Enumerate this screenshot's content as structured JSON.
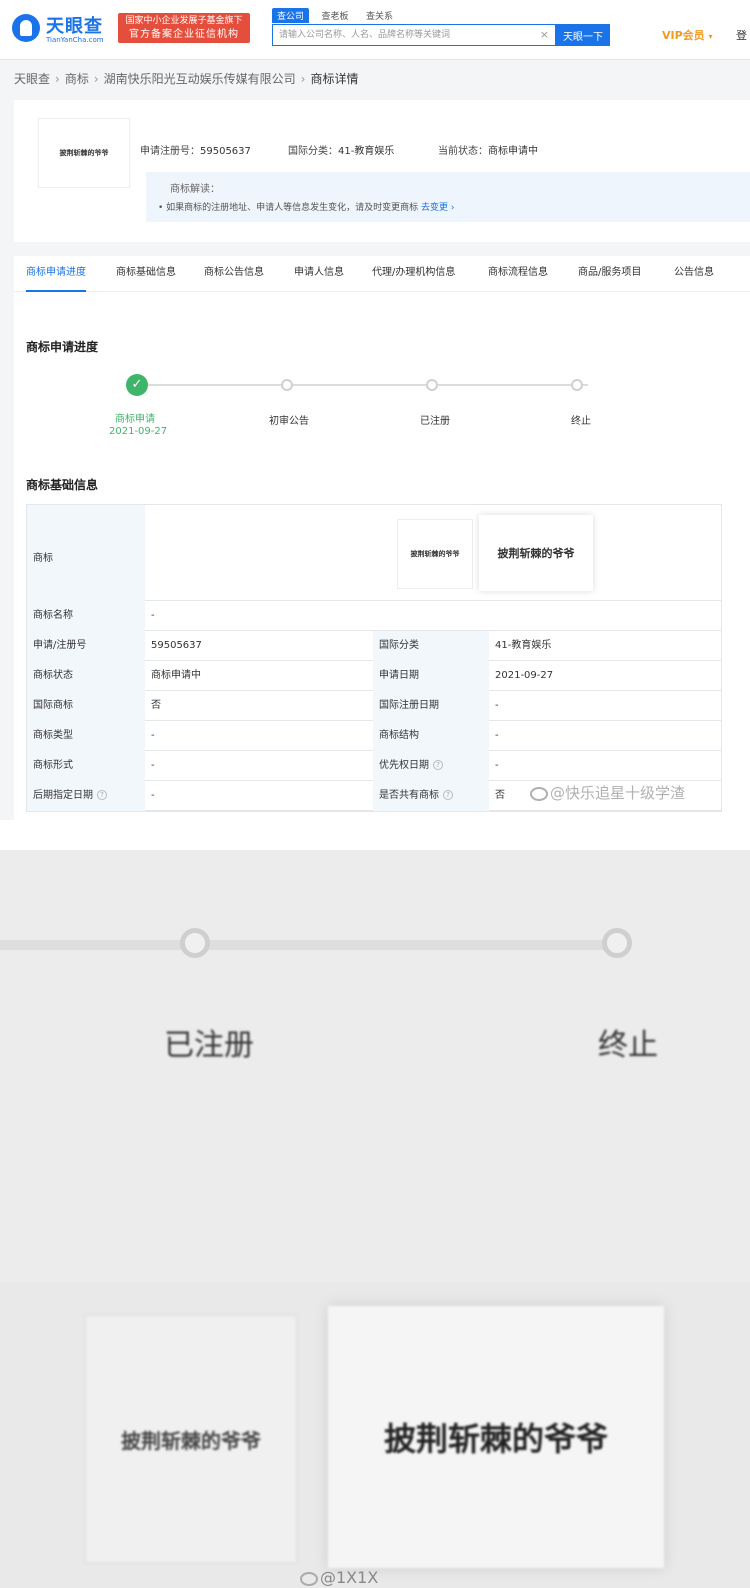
{
  "header": {
    "logo_text": "天眼查",
    "logo_sub": "TianYanCha.com",
    "badge_line1": "国家中小企业发展子基金旗下",
    "badge_line2": "官方备案企业征信机构",
    "search_tabs": [
      "查公司",
      "查老板",
      "查关系"
    ],
    "search_placeholder": "请输入公司名称、人名、品牌名称等关键词",
    "clear_symbol": "×",
    "search_button": "天眼一下",
    "vip_label": "VIP会员",
    "vip_caret": "▾",
    "cut_text": "登"
  },
  "breadcrumb": {
    "items": [
      "天眼查",
      "商标",
      "湖南快乐阳光互动娱乐传媒有限公司",
      "商标详情"
    ],
    "separator": "›"
  },
  "summary": {
    "thumb_text": "披荆斩棘的爷爷",
    "reg_label": "申请注册号：",
    "reg_value": "59505637",
    "class_label": "国际分类：",
    "class_value": "41-教育娱乐",
    "status_label": "当前状态：",
    "status_value": "商标申请中",
    "explain_title": "商标解读：",
    "explain_text": "• 如果商标的注册地址、申请人等信息发生变化，请及时变更商标",
    "explain_link": "去变更 ›"
  },
  "tabs": [
    "商标申请进度",
    "商标基础信息",
    "商标公告信息",
    "申请人信息",
    "代理/办理机构信息",
    "商标流程信息",
    "商品/服务项目",
    "公告信息"
  ],
  "progress": {
    "title": "商标申请进度",
    "check_icon": "✓",
    "steps": [
      {
        "label": "商标申请",
        "date": "2021-09-27"
      },
      {
        "label": "初审公告"
      },
      {
        "label": "已注册"
      },
      {
        "label": "终止"
      }
    ]
  },
  "basic_info": {
    "title": "商标基础信息",
    "trademark_label": "商标",
    "trademark_text": "披荆斩棘的爷爷",
    "name_label": "商标名称",
    "name_value": "-",
    "help_symbol": "?",
    "rows": [
      {
        "l1": "申请/注册号",
        "v1": "59505637",
        "l2": "国际分类",
        "v2": "41-教育娱乐"
      },
      {
        "l1": "商标状态",
        "v1": "商标申请中",
        "l2": "申请日期",
        "v2": "2021-09-27"
      },
      {
        "l1": "国际商标",
        "v1": "否",
        "l2": "国际注册日期",
        "v2": "-"
      },
      {
        "l1": "商标类型",
        "v1": "-",
        "l2": "商标结构",
        "v2": "-"
      },
      {
        "l1": "商标形式",
        "v1": "-",
        "l2": "优先权日期",
        "v2": "-"
      },
      {
        "l1": "后期指定日期",
        "v1": "-",
        "l2": "是否共有商标",
        "v2": "否"
      }
    ]
  },
  "watermark_top": "@快乐追星十级学渣",
  "zoom": {
    "label_registered": "已注册",
    "label_terminated": "终止",
    "trademark_small": "披荆斩棘的爷爷",
    "trademark_big": "披荆斩棘的爷爷",
    "watermark": "@1X1X"
  }
}
